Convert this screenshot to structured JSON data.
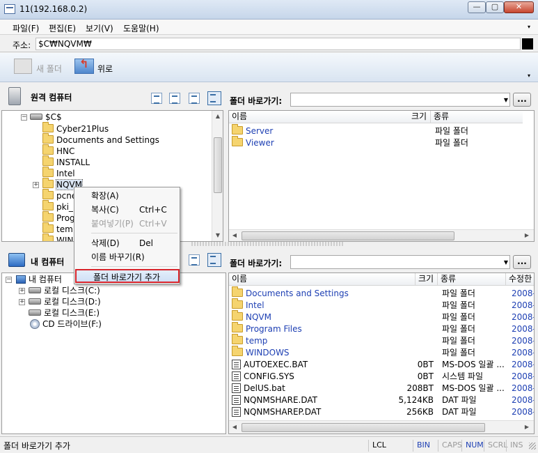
{
  "window": {
    "title": "11(192.168.0.2)",
    "btn_min": "—",
    "btn_max": "▢",
    "btn_close": "✕"
  },
  "menu": [
    "파일(F)",
    "편집(E)",
    "보기(V)",
    "도움말(H)"
  ],
  "address": {
    "label": "주소:",
    "value": "$C₩NQVM₩"
  },
  "toolbar": {
    "new_folder": "새 폴더",
    "up": "위로"
  },
  "remote": {
    "header": "원격 컴퓨터",
    "shortcut_label": "폴더 바로가기:",
    "dots": "...",
    "tree_root": "$C$",
    "tree": [
      "Cyber21Plus",
      "Documents and Settings",
      "HNC",
      "INSTALL",
      "Intel",
      "NQVM",
      "pcne",
      "pki_",
      "Prog",
      "tem",
      "WIN"
    ],
    "columns": [
      "이름",
      "크기",
      "종류"
    ],
    "files": [
      {
        "name": "Server",
        "size": "",
        "type": "파일 폴더"
      },
      {
        "name": "Viewer",
        "size": "",
        "type": "파일 폴더"
      }
    ]
  },
  "local": {
    "header": "내 컴퓨터",
    "shortcut_label": "폴더 바로가기:",
    "dots": "...",
    "tree_root": "내 컴퓨터",
    "tree": [
      "로컬 디스크(C:)",
      "로컬 디스크(D:)",
      "로컬 디스크(E:)",
      "CD 드라이브(F:)"
    ],
    "columns": [
      "이름",
      "크기",
      "종류",
      "수정한"
    ],
    "files": [
      {
        "name": "Documents and Settings",
        "size": "",
        "type": "파일 폴더",
        "date": "2008-"
      },
      {
        "name": "Intel",
        "size": "",
        "type": "파일 폴더",
        "date": "2008-"
      },
      {
        "name": "NQVM",
        "size": "",
        "type": "파일 폴더",
        "date": "2008-"
      },
      {
        "name": "Program Files",
        "size": "",
        "type": "파일 폴더",
        "date": "2008-"
      },
      {
        "name": "temp",
        "size": "",
        "type": "파일 폴더",
        "date": "2008-"
      },
      {
        "name": "WINDOWS",
        "size": "",
        "type": "파일 폴더",
        "date": "2008-"
      },
      {
        "name": "AUTOEXEC.BAT",
        "size": "0BT",
        "type": "MS-DOS 일괄 ...",
        "date": "2008-"
      },
      {
        "name": "CONFIG.SYS",
        "size": "0BT",
        "type": "시스템 파일",
        "date": "2008-"
      },
      {
        "name": "DelUS.bat",
        "size": "208BT",
        "type": "MS-DOS 일괄 ...",
        "date": "2008-"
      },
      {
        "name": "NQNMSHARE.DAT",
        "size": "5,124KB",
        "type": "DAT 파일",
        "date": "2008-"
      },
      {
        "name": "NQNMSHAREP.DAT",
        "size": "256KB",
        "type": "DAT 파일",
        "date": "2008-"
      }
    ]
  },
  "context_menu": {
    "expand": "확장(A)",
    "copy": "복사(C)",
    "copy_key": "Ctrl+C",
    "paste": "붙여넣기(P)",
    "paste_key": "Ctrl+V",
    "delete": "삭제(D)",
    "delete_key": "Del",
    "rename": "이름 바꾸기(R)",
    "add_shortcut": "폴더 바로가기 추가"
  },
  "status": {
    "text": "폴더 바로가기 추가",
    "lcl": "LCL",
    "bin": "BIN",
    "caps": "CAPS",
    "num": "NUM",
    "scrl": "SCRL",
    "ins": "INS"
  }
}
